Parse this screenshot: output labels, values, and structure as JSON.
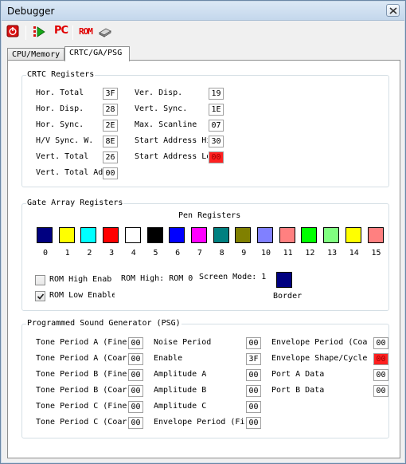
{
  "window": {
    "title": "Debugger"
  },
  "toolbar": {
    "pc_label": "PC",
    "rom_label": "ROM"
  },
  "tabs": [
    {
      "label": "CPU/Memory",
      "active": false
    },
    {
      "label": "CRTC/GA/PSG",
      "active": true
    }
  ],
  "crtc": {
    "title": "CRTC Registers",
    "left": [
      {
        "label": "Hor. Total",
        "value": "3F",
        "highlight": false
      },
      {
        "label": "Hor. Disp.",
        "value": "28",
        "highlight": false
      },
      {
        "label": "Hor. Sync.",
        "value": "2E",
        "highlight": false
      },
      {
        "label": "H/V Sync. W.",
        "value": "8E",
        "highlight": false
      },
      {
        "label": "Vert. Total",
        "value": "26",
        "highlight": false
      },
      {
        "label": "Vert. Total Adj.",
        "value": "00",
        "highlight": false
      }
    ],
    "right": [
      {
        "label": "Ver. Disp.",
        "value": "19",
        "highlight": false
      },
      {
        "label": "Vert. Sync.",
        "value": "1E",
        "highlight": false
      },
      {
        "label": "Max. Scanline",
        "value": "07",
        "highlight": false
      },
      {
        "label": "Start Address High",
        "value": "30",
        "highlight": false
      },
      {
        "label": "Start Address Low",
        "value": "00",
        "highlight": true
      }
    ]
  },
  "gate_array": {
    "title": "Gate Array Registers",
    "pen_title": "Pen Registers",
    "pens": [
      {
        "num": "0",
        "color": "#000080"
      },
      {
        "num": "1",
        "color": "#ffff00"
      },
      {
        "num": "2",
        "color": "#00ffff"
      },
      {
        "num": "3",
        "color": "#ff0000"
      },
      {
        "num": "4",
        "color": "#ffffff"
      },
      {
        "num": "5",
        "color": "#000000"
      },
      {
        "num": "6",
        "color": "#0000ff"
      },
      {
        "num": "7",
        "color": "#ff00ff"
      },
      {
        "num": "8",
        "color": "#008080"
      },
      {
        "num": "9",
        "color": "#808000"
      },
      {
        "num": "10",
        "color": "#8080ff"
      },
      {
        "num": "11",
        "color": "#ff8080"
      },
      {
        "num": "12",
        "color": "#00ff00"
      },
      {
        "num": "13",
        "color": "#80ff80"
      },
      {
        "num": "14",
        "color": "#ffff00"
      },
      {
        "num": "15",
        "color": "#ff8080"
      }
    ],
    "rom_high_label": "ROM High Enabled",
    "rom_high_checked": false,
    "rom_low_label": "ROM Low Enabled",
    "rom_low_checked": true,
    "rom_high_text": "ROM High: ROM 0",
    "screen_mode_text": "Screen Mode: 1",
    "border_label": "Border",
    "border_color": "#000080"
  },
  "psg": {
    "title": "Programmed Sound Generator (PSG)",
    "col1": [
      {
        "label": "Tone Period A (Fine)",
        "value": "00",
        "highlight": false
      },
      {
        "label": "Tone Period A (Coarse)",
        "value": "00",
        "highlight": false
      },
      {
        "label": "Tone Period B (Fine)",
        "value": "00",
        "highlight": false
      },
      {
        "label": "Tone Period B (Coarse)",
        "value": "00",
        "highlight": false
      },
      {
        "label": "Tone Period C (Fine)",
        "value": "00",
        "highlight": false
      },
      {
        "label": "Tone Period C (Coarse)",
        "value": "00",
        "highlight": false
      }
    ],
    "col2": [
      {
        "label": "Noise Period",
        "value": "00",
        "highlight": false
      },
      {
        "label": "Enable",
        "value": "3F",
        "highlight": false
      },
      {
        "label": "Amplitude A",
        "value": "00",
        "highlight": false
      },
      {
        "label": "Amplitude B",
        "value": "00",
        "highlight": false
      },
      {
        "label": "Amplitude C",
        "value": "00",
        "highlight": false
      },
      {
        "label": "Envelope Period (Fine)",
        "value": "00",
        "highlight": false
      }
    ],
    "col3": [
      {
        "label": "Envelope Period (Coarse)",
        "value": "00",
        "highlight": false
      },
      {
        "label": "Envelope Shape/Cycle",
        "value": "00",
        "highlight": true
      },
      {
        "label": "Port A Data",
        "value": "00",
        "highlight": false
      },
      {
        "label": "Port B Data",
        "value": "00",
        "highlight": false
      }
    ]
  }
}
